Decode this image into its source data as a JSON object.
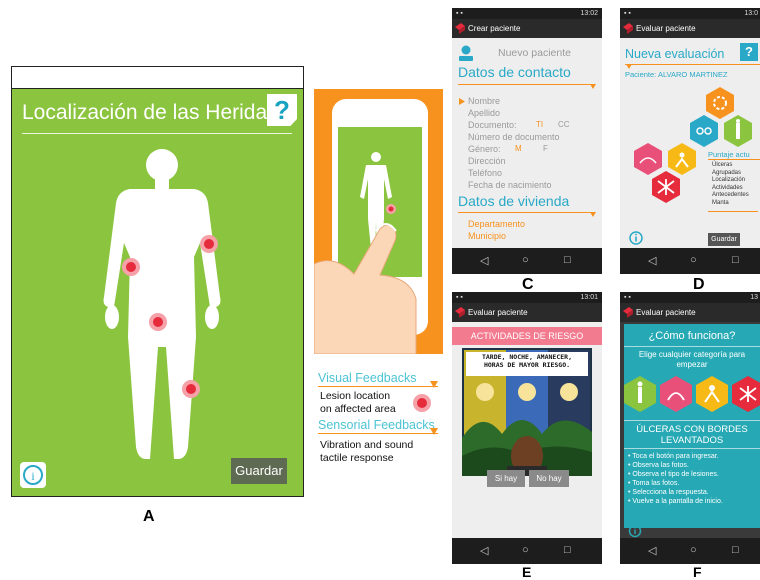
{
  "panel_labels": {
    "a": "A",
    "c": "C",
    "d": "D",
    "e": "E",
    "f": "F"
  },
  "panel_a": {
    "title": "Localización de las Heridas",
    "help": "?",
    "save_label": "Guardar",
    "info": "i"
  },
  "feedback": {
    "visual_title": "Visual Feedbacks",
    "visual_desc": [
      "Lesion location",
      "on affected area"
    ],
    "sensorial_title": "Sensorial Feedbacks",
    "sensorial_desc": [
      "Vibration and sound",
      "tactile response"
    ]
  },
  "screen_c": {
    "clock": "13:02",
    "app_title": "Crear paciente",
    "new_patient": "Nuevo paciente",
    "contact_header": "Datos de contacto",
    "fields": [
      "Nombre",
      "Apellido",
      "Documento:",
      "Número de documento",
      "Género:",
      "Dirección",
      "Teléfono",
      "Fecha de nacimiento"
    ],
    "doc_options": [
      "TI",
      "CC"
    ],
    "gender_options": [
      "M",
      "F"
    ],
    "housing_header": "Datos de vivienda",
    "housing_fields": [
      "Departamento",
      "Municipio"
    ]
  },
  "screen_d": {
    "clock": "13:0",
    "app_title": "Evaluar paciente",
    "header": "Nueva evaluación",
    "help": "?",
    "patient": "Paciente: ALVARO MARTINEZ",
    "score_title": "Puntaje actu",
    "score_items": [
      "Úlceras",
      "Agrupadas",
      "Localización",
      "Actividades",
      "Antecedentes",
      "Manta"
    ],
    "save_label": "Guardar"
  },
  "screen_e": {
    "clock": "13:01",
    "app_title": "Evaluar paciente",
    "header": "ACTIVIDADES DE RIESGO",
    "caption": [
      "TARDE, NOCHE, AMANECER,",
      "HORAS DE MAYOR RIESGO."
    ],
    "yes": "Si hay",
    "no": "No hay"
  },
  "screen_f": {
    "clock": "13",
    "app_title": "Evaluar paciente",
    "how_title": "¿Cómo funciona?",
    "how_desc": [
      "Elige cualquier categoría para",
      "empezar"
    ],
    "section_title": [
      "ÚLCERAS CON BORDES",
      "LEVANTADOS"
    ],
    "steps": [
      "• Toca el botón para ingresar.",
      "• Observa las fotos.",
      "• Observa el tipo de lesiones.",
      "• Toma las fotos.",
      "• Selecciona la respuesta.",
      "• Vuelve a la pantalla de inicio."
    ]
  },
  "nav_icons": [
    "back-icon",
    "home-icon",
    "recents-icon"
  ],
  "colors": {
    "green": "#8bc43f",
    "orange": "#f7921e",
    "teal": "#29a9c7",
    "red": "#e52b3c",
    "yellow": "#f6b915"
  }
}
